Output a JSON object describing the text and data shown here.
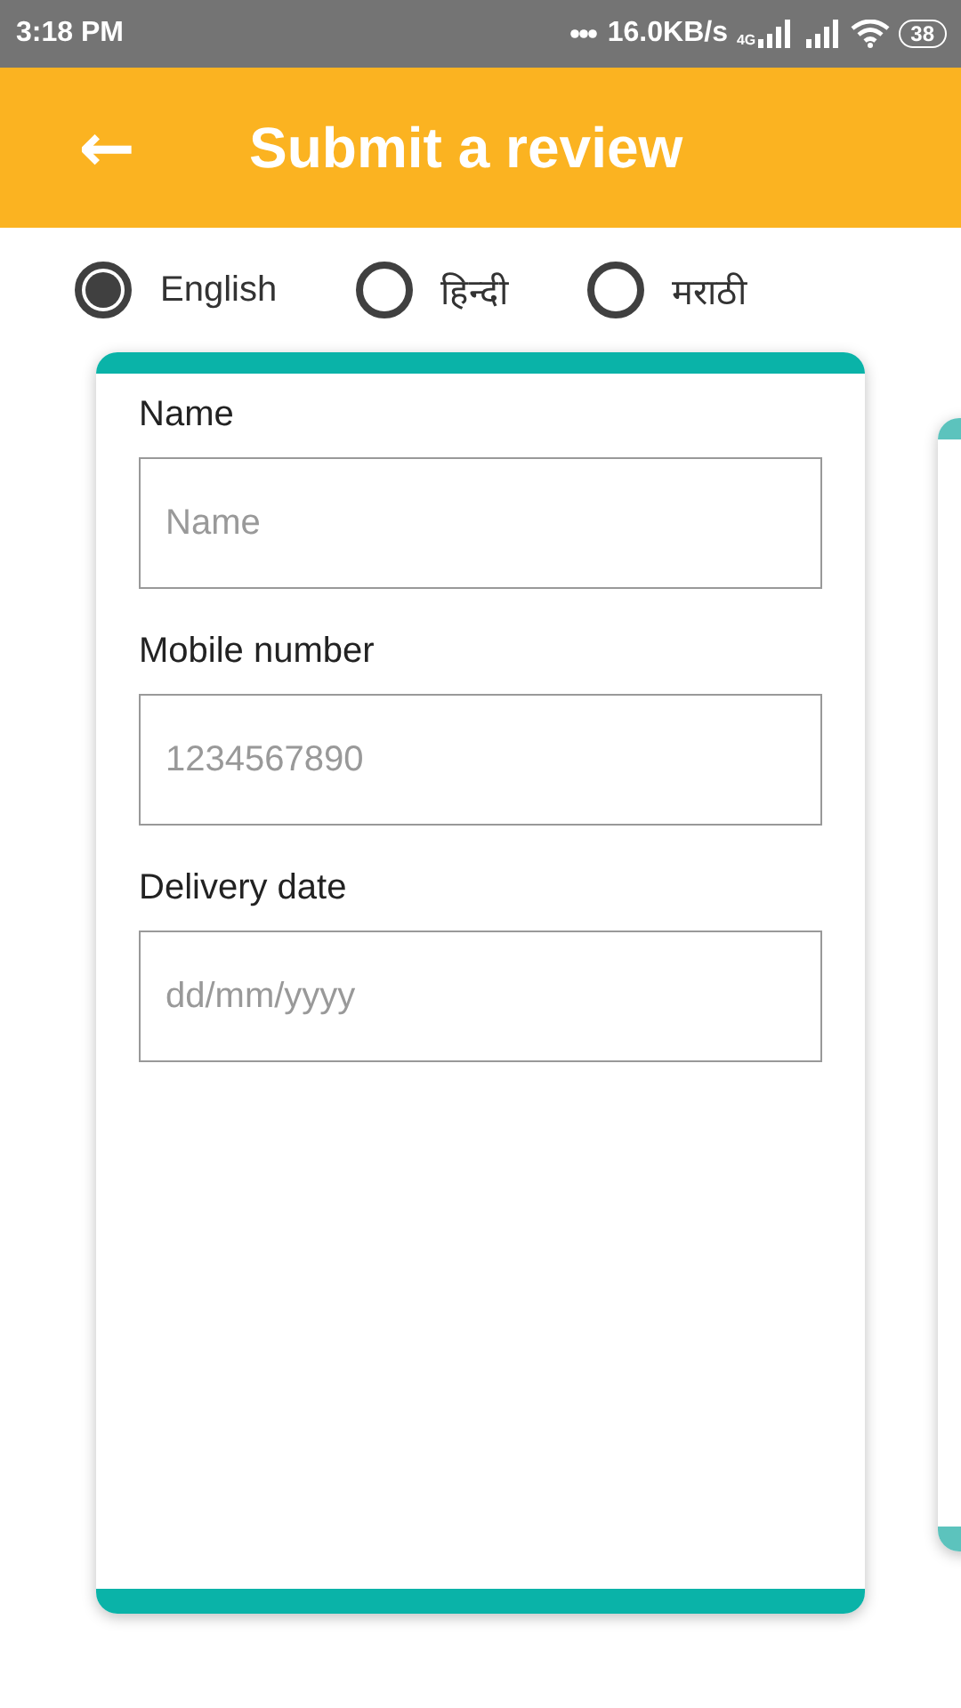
{
  "status_bar": {
    "time": "3:18 PM",
    "speed": "16.0KB/s",
    "network": "4G",
    "battery": "38"
  },
  "header": {
    "back_icon": "←",
    "title": "Submit a review"
  },
  "languages": [
    {
      "label": "English",
      "selected": true
    },
    {
      "label": "हिन्दी",
      "selected": false
    },
    {
      "label": "मराठी",
      "selected": false
    }
  ],
  "form": {
    "fields": [
      {
        "label": "Name",
        "placeholder": "Name"
      },
      {
        "label": "Mobile number",
        "placeholder": "1234567890"
      },
      {
        "label": "Delivery date",
        "placeholder": "dd/mm/yyyy"
      }
    ]
  }
}
